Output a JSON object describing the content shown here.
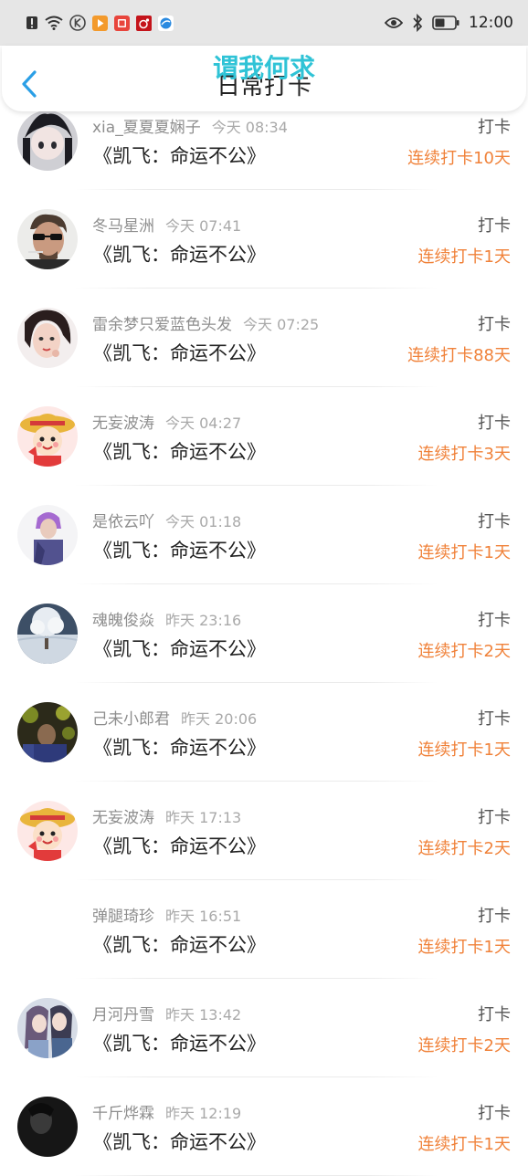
{
  "status_bar": {
    "time": "12:00",
    "left_icons": [
      "alert-icon",
      "wifi-icon",
      "k-app-icon",
      "play-app-icon",
      "red-app-icon",
      "weibo-app-icon",
      "browser-app-icon"
    ],
    "right_icons": [
      "eye-icon",
      "bluetooth-icon",
      "battery-icon"
    ]
  },
  "header": {
    "title": "日常打卡",
    "watermark": "谓我何求",
    "back_icon": "chevron-left-icon",
    "accent_color": "#2b9fe6"
  },
  "colors": {
    "streak": "#f0823a",
    "watermark": "#2fc3d6"
  },
  "rows": [
    {
      "name": "xia_夏夏夏娴子",
      "time": "今天 08:34",
      "book": "《凯飞：命运不公》",
      "action": "打卡",
      "streak": "连续打卡10天"
    },
    {
      "name": "冬马星洲",
      "time": "今天 07:41",
      "book": "《凯飞：命运不公》",
      "action": "打卡",
      "streak": "连续打卡1天"
    },
    {
      "name": "雷余梦只爱蓝色头发",
      "time": "今天 07:25",
      "book": "《凯飞：命运不公》",
      "action": "打卡",
      "streak": "连续打卡88天"
    },
    {
      "name": "无妄波涛",
      "time": "今天 04:27",
      "book": "《凯飞：命运不公》",
      "action": "打卡",
      "streak": "连续打卡3天"
    },
    {
      "name": "是依云吖",
      "time": "今天 01:18",
      "book": "《凯飞：命运不公》",
      "action": "打卡",
      "streak": "连续打卡1天"
    },
    {
      "name": "魂魄俊焱",
      "time": "昨天 23:16",
      "book": "《凯飞：命运不公》",
      "action": "打卡",
      "streak": "连续打卡2天"
    },
    {
      "name": "己未小郎君",
      "time": "昨天 20:06",
      "book": "《凯飞：命运不公》",
      "action": "打卡",
      "streak": "连续打卡1天"
    },
    {
      "name": "无妄波涛",
      "time": "昨天 17:13",
      "book": "《凯飞：命运不公》",
      "action": "打卡",
      "streak": "连续打卡2天"
    },
    {
      "name": "弹腿琦珍",
      "time": "昨天 16:51",
      "book": "《凯飞：命运不公》",
      "action": "打卡",
      "streak": "连续打卡1天"
    },
    {
      "name": "月河丹雪",
      "time": "昨天 13:42",
      "book": "《凯飞：命运不公》",
      "action": "打卡",
      "streak": "连续打卡2天"
    },
    {
      "name": "千斤烨霖",
      "time": "昨天 12:19",
      "book": "《凯飞：命运不公》",
      "action": "打卡",
      "streak": "连续打卡1天"
    }
  ]
}
